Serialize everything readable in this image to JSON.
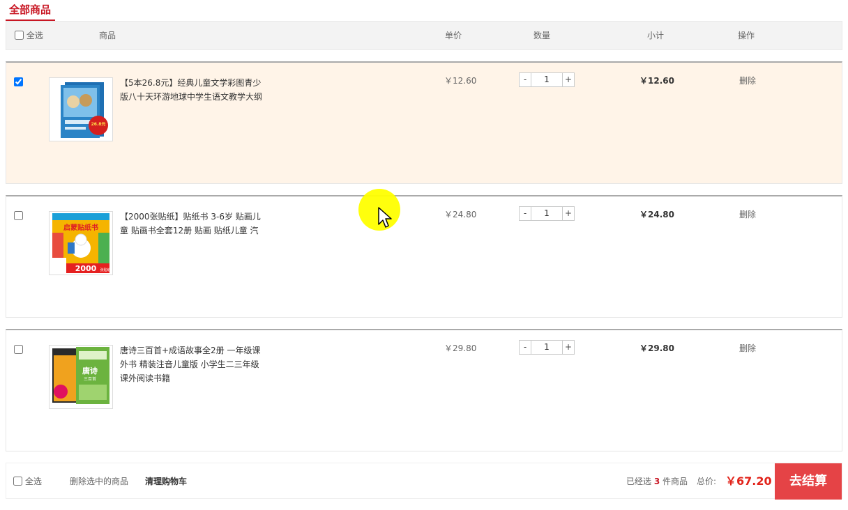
{
  "tabs": {
    "all_goods": "全部商品"
  },
  "header": {
    "select_all": "全选",
    "col_goods": "商品",
    "col_price": "单价",
    "col_qty": "数量",
    "col_subtotal": "小计",
    "col_action": "操作"
  },
  "items": [
    {
      "checked": true,
      "title": "【5本26.8元】经典儿童文学彩图青少版八十天环游地球中学生语文教学大纲",
      "price": "￥12.60",
      "qty": "1",
      "subtotal": "￥12.60",
      "delete_label": "删除",
      "cover_badge": "26.8元",
      "cover_theme": "#2b84c6"
    },
    {
      "checked": false,
      "title": "【2000张贴纸】贴纸书 3-6岁 贴画儿童 贴画书全套12册 贴画 贴纸儿童 汽",
      "price": "￥24.80",
      "qty": "1",
      "subtotal": "￥24.80",
      "delete_label": "删除",
      "cover_badge": "2000",
      "cover_label": "张贴纸",
      "cover_head": "启蒙贴纸书",
      "cover_theme": "#f5b400"
    },
    {
      "checked": false,
      "title": "唐诗三百首+成语故事全2册 一年级课外书 精装注音儿童版 小学生二三年级课外阅读书籍",
      "price": "￥29.80",
      "qty": "1",
      "subtotal": "￥29.80",
      "delete_label": "删除",
      "cover_head": "唐诗",
      "cover_sub": "三百首",
      "cover_theme": "#6cb33f"
    }
  ],
  "qty_controls": {
    "minus": "-",
    "plus": "+"
  },
  "footer": {
    "select_all": "全选",
    "delete_selected": "删除选中的商品",
    "clear_cart": "清理购物车",
    "selected_prefix": "已经选",
    "selected_count": "3",
    "selected_suffix": "件商品",
    "total_label": "总价:",
    "total_value": "￥67.20",
    "checkout_label": "去结算"
  },
  "colors": {
    "brand_red": "#c81623",
    "checkout_bg": "#e54346",
    "selected_row_bg": "#fff4e8",
    "cursor_highlight": "#ffff00"
  }
}
